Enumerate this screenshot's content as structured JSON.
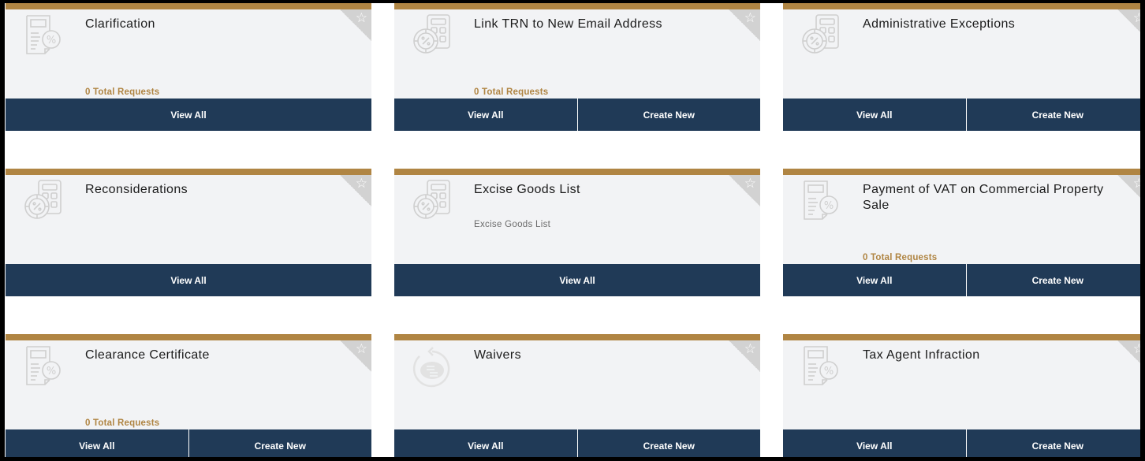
{
  "colors": {
    "accent_gold": "#b08543",
    "button_navy": "#203a57",
    "card_bg": "#f2f3f5",
    "corner_gray": "#d2d2d2"
  },
  "cards": [
    {
      "title": "Clarification",
      "icon": "tax-document-percent-icon",
      "subtitle": "",
      "count_text": "0 Total Requests",
      "buttons": [
        "View All"
      ]
    },
    {
      "title": "Link TRN to New Email Address",
      "icon": "calculator-percent-coin-icon",
      "subtitle": "",
      "count_text": "0 Total Requests",
      "buttons": [
        "View All",
        "Create New"
      ]
    },
    {
      "title": "Administrative Exceptions",
      "icon": "calculator-percent-coin-icon",
      "subtitle": "",
      "count_text": "",
      "buttons": [
        "View All",
        "Create New"
      ]
    },
    {
      "title": "Reconsiderations",
      "icon": "calculator-percent-coin-icon",
      "subtitle": "",
      "count_text": "",
      "buttons": [
        "View All"
      ]
    },
    {
      "title": "Excise Goods List",
      "icon": "calculator-percent-coin-icon",
      "subtitle": "Excise Goods List",
      "count_text": "",
      "buttons": [
        "View All"
      ]
    },
    {
      "title": "Payment of VAT on Commercial Property Sale",
      "icon": "tax-document-percent-icon",
      "subtitle": "",
      "count_text": "0 Total Requests",
      "buttons": [
        "View All",
        "Create New"
      ]
    },
    {
      "title": "Clearance Certificate",
      "icon": "tax-document-percent-icon",
      "subtitle": "",
      "count_text": "0 Total Requests",
      "buttons": [
        "View All",
        "Create New"
      ]
    },
    {
      "title": "Waivers",
      "icon": "refund-coins-icon",
      "subtitle": "",
      "count_text": "",
      "buttons": [
        "View All",
        "Create New"
      ]
    },
    {
      "title": "Tax Agent Infraction",
      "icon": "tax-document-percent-icon",
      "subtitle": "",
      "count_text": "",
      "buttons": [
        "View All",
        "Create New"
      ]
    }
  ],
  "favorite_icon": "star-outline-icon"
}
